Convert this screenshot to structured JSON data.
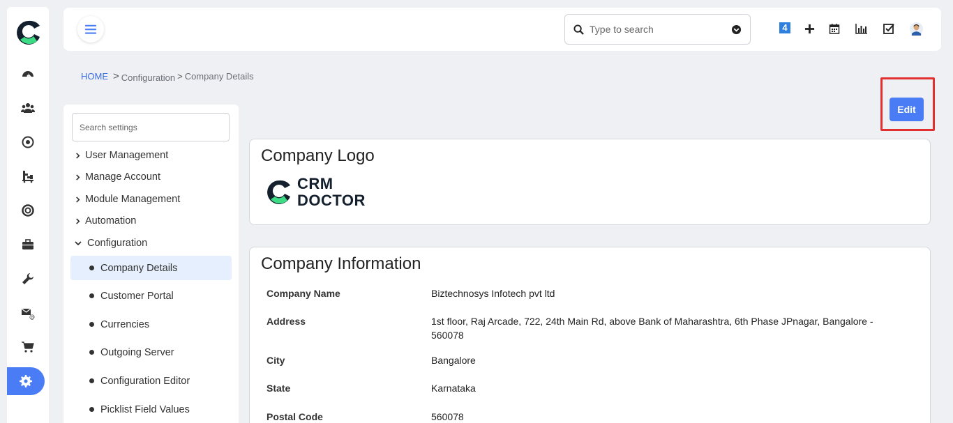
{
  "search": {
    "placeholder": "Type to search"
  },
  "header": {
    "notification_count": "4"
  },
  "breadcrumb": {
    "home": "HOME",
    "sep": ">",
    "item1": "Configuration",
    "item2": "Company Details"
  },
  "settings": {
    "search_placeholder": "Search settings",
    "groups": [
      "User Management",
      "Manage Account",
      "Module Management",
      "Automation",
      "Configuration"
    ],
    "sub_items": [
      "Company Details",
      "Customer Portal",
      "Currencies",
      "Outgoing Server",
      "Configuration Editor",
      "Picklist Field Values"
    ]
  },
  "edit_label": "Edit",
  "logo_card": {
    "title": "Company Logo",
    "logo_line1": "CRM",
    "logo_line2": "DOCTOR"
  },
  "info_card": {
    "title": "Company Information",
    "rows": [
      {
        "label": "Company Name",
        "value": "Biztechnosys Infotech pvt ltd"
      },
      {
        "label": "Address",
        "value": "1st floor, Raj Arcade, 722, 24th Main Rd, above Bank of Maharashtra, 6th Phase JPnagar, Bangalore - 560078"
      },
      {
        "label": "City",
        "value": "Bangalore"
      },
      {
        "label": "State",
        "value": "Karnataka"
      },
      {
        "label": "Postal Code",
        "value": "560078"
      }
    ]
  },
  "colors": {
    "accent": "#4a7cf6",
    "logo_green": "#3ddc84",
    "logo_dark": "#14202e",
    "highlight": "#e03030"
  },
  "rail_icons": [
    "dashboard-icon",
    "users-icon",
    "target-icon",
    "org-chart-icon",
    "support-icon",
    "briefcase-icon",
    "wrench-icon",
    "email-icon",
    "cart-icon",
    "settings-gear-icon"
  ]
}
